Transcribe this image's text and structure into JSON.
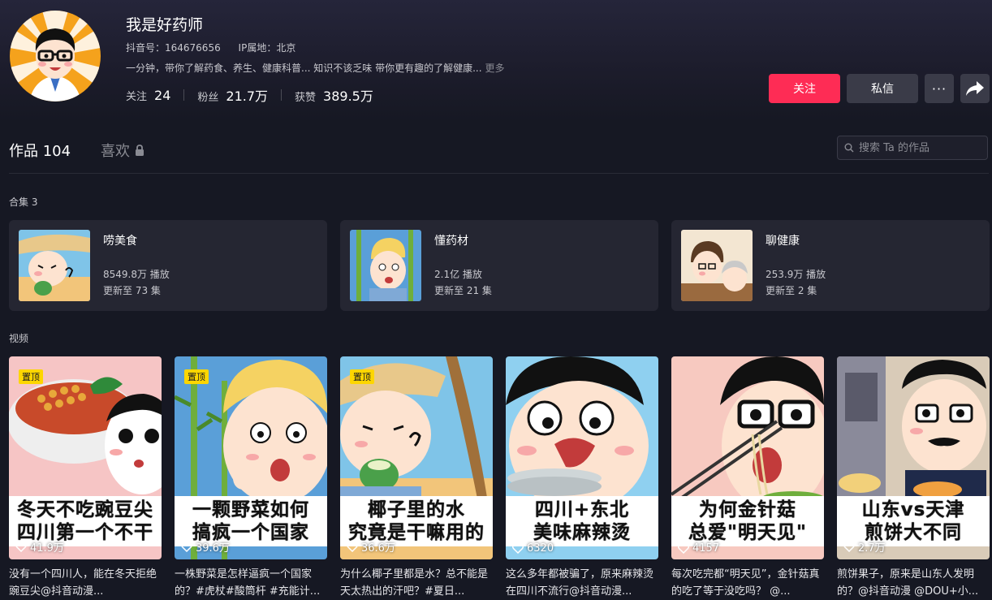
{
  "profile": {
    "name": "我是好药师",
    "douyin_id": "抖音号：164676656",
    "ip_location": "IP属地：北京",
    "bio": "一分钟，带你了解药食、养生、健康科普... 知识不该乏味 带你更有趣的了解健康...",
    "bio_more": "更多",
    "stats": [
      {
        "label": "关注",
        "value": "24"
      },
      {
        "label": "粉丝",
        "value": "21.7万"
      },
      {
        "label": "获赞",
        "value": "389.5万"
      }
    ]
  },
  "actions": {
    "follow": "关注",
    "message": "私信",
    "more": "···"
  },
  "tabs": {
    "works": "作品 104",
    "likes": "喜欢"
  },
  "search": {
    "placeholder": "搜索 Ta 的作品"
  },
  "collections_label": "合集 3",
  "collections": [
    {
      "title": "唠美食",
      "plays": "8549.8万 播放",
      "episodes": "更新至 73 集"
    },
    {
      "title": "懂药材",
      "plays": "2.1亿 播放",
      "episodes": "更新至 21 集"
    },
    {
      "title": "聊健康",
      "plays": "253.9万 播放",
      "episodes": "更新至 2 集"
    }
  ],
  "videos_label": "视频",
  "videos": [
    {
      "pinned": "置顶",
      "banner": [
        "冬天不吃豌豆尖",
        "四川第一个不干"
      ],
      "likes": "41.9万",
      "caption": "没有一个四川人，能在冬天拒绝豌豆尖@抖音动漫..."
    },
    {
      "pinned": "置顶",
      "banner": [
        "一颗野菜如何",
        "搞疯一个国家"
      ],
      "likes": "39.6万",
      "caption": "一株野菜是怎样逼疯一个国家的？#虎杖#酸筒杆 #充能计..."
    },
    {
      "pinned": "置顶",
      "banner": [
        "椰子里的水",
        "究竟是干嘛用的"
      ],
      "likes": "36.6万",
      "caption": "为什么椰子里都是水？总不能是天太热出的汗吧？#夏日..."
    },
    {
      "pinned": "",
      "banner": [
        "四川+东北",
        "美味麻辣烫"
      ],
      "likes": "6320",
      "caption": "这么多年都被骗了，原来麻辣烫在四川不流行@抖音动漫..."
    },
    {
      "pinned": "",
      "banner": [
        "为何金针菇",
        "总爱\"明天见\""
      ],
      "likes": "4157",
      "caption": "每次吃完都“明天见”，金针菇真的吃了等于没吃吗？ @..."
    },
    {
      "pinned": "",
      "banner": [
        "山东vs天津",
        "煎饼大不同"
      ],
      "likes": "2.7万",
      "caption": "煎饼果子，原来是山东人发明的？@抖音动漫 @DOU+小..."
    }
  ],
  "colors": {
    "accent": "#fe2c55",
    "background": "#161823",
    "pin": "#fdd600"
  }
}
